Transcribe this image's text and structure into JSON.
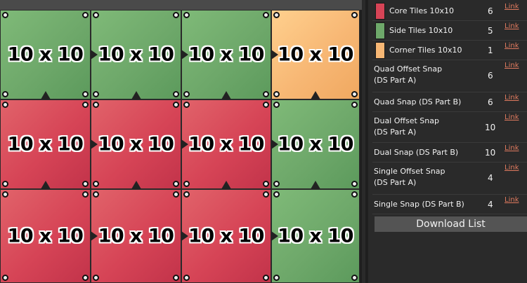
{
  "board": {
    "tiles": [
      {
        "type": "side",
        "label": "10 x 10"
      },
      {
        "type": "side",
        "label": "10 x 10"
      },
      {
        "type": "side",
        "label": "10 x 10"
      },
      {
        "type": "corner",
        "label": "10 x 10"
      },
      {
        "type": "core",
        "label": "10 x 10"
      },
      {
        "type": "core",
        "label": "10 x 10"
      },
      {
        "type": "core",
        "label": "10 x 10"
      },
      {
        "type": "side",
        "label": "10 x 10"
      },
      {
        "type": "core",
        "label": "10 x 10"
      },
      {
        "type": "core",
        "label": "10 x 10"
      },
      {
        "type": "core",
        "label": "10 x 10"
      },
      {
        "type": "side",
        "label": "10 x 10"
      }
    ]
  },
  "parts": {
    "items": [
      {
        "label": "Core Tiles 10x10",
        "count": "6",
        "link": "Link",
        "swatch": "#d64456"
      },
      {
        "label": "Side Tiles 10x10",
        "count": "5",
        "link": "Link",
        "swatch": "#6ea86a"
      },
      {
        "label": "Corner Tiles 10x10",
        "count": "1",
        "link": "Link",
        "swatch": "#f7b774"
      },
      {
        "label": "Quad Offset Snap\n(DS Part A)",
        "count": "6",
        "link": "Link"
      },
      {
        "label": "Quad Snap (DS Part B)",
        "count": "6",
        "link": "Link"
      },
      {
        "label": "Dual Offset Snap\n(DS Part A)",
        "count": "10",
        "link": "Link"
      },
      {
        "label": "Dual Snap (DS Part B)",
        "count": "10",
        "link": "Link"
      },
      {
        "label": "Single Offset Snap\n(DS Part A)",
        "count": "4",
        "link": "Link"
      },
      {
        "label": "Single Snap (DS Part B)",
        "count": "4",
        "link": "Link"
      }
    ],
    "download_label": "Download List"
  }
}
